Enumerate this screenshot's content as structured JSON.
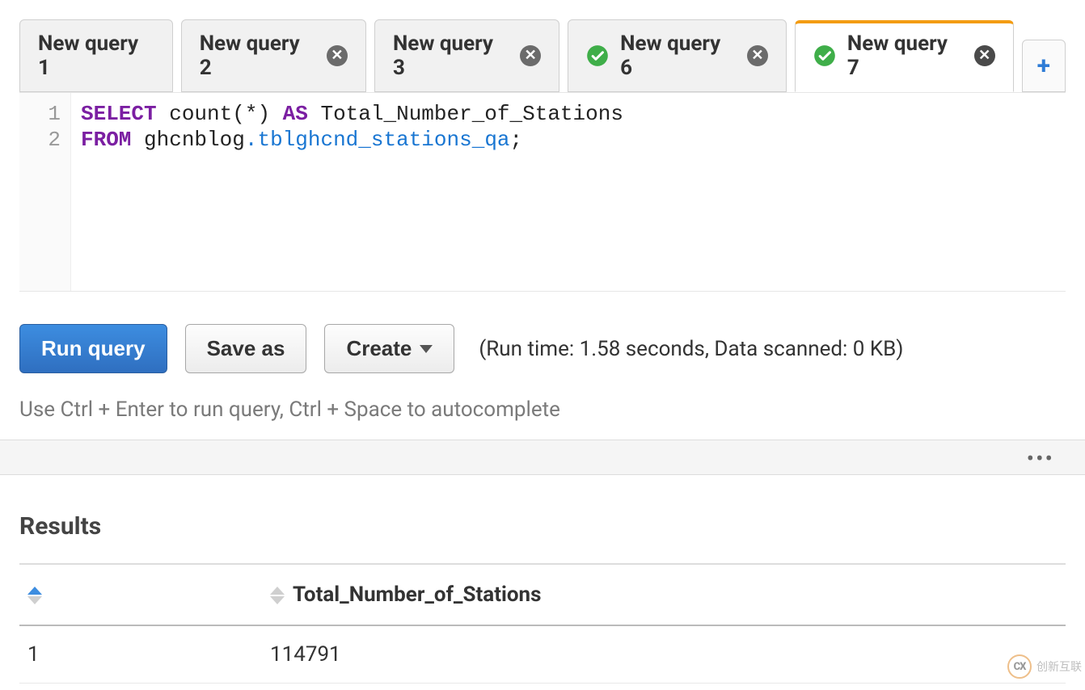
{
  "tabs": {
    "items": [
      {
        "label": "New query 1",
        "closable": false,
        "success": false,
        "active": false
      },
      {
        "label": "New query 2",
        "closable": true,
        "success": false,
        "active": false
      },
      {
        "label": "New query 3",
        "closable": true,
        "success": false,
        "active": false
      },
      {
        "label": "New query 6",
        "closable": true,
        "success": true,
        "active": false
      },
      {
        "label": "New query 7",
        "closable": true,
        "success": true,
        "active": true
      }
    ],
    "add_label": "+"
  },
  "editor": {
    "lines": [
      {
        "n": "1",
        "tokens": [
          {
            "t": "SELECT",
            "c": "kw"
          },
          {
            "t": " count(*) "
          },
          {
            "t": "AS",
            "c": "kw"
          },
          {
            "t": " Total_Number_of_Stations"
          }
        ]
      },
      {
        "n": "2",
        "tokens": [
          {
            "t": "FROM",
            "c": "kw"
          },
          {
            "t": " ghcnblog"
          },
          {
            "t": ".",
            "c": "dot"
          },
          {
            "t": "tblghcnd_stations_qa",
            "c": "tbl"
          },
          {
            "t": ";"
          }
        ]
      }
    ]
  },
  "actions": {
    "run_label": "Run query",
    "save_label": "Save as",
    "create_label": "Create",
    "run_info": "(Run time: 1.58 seconds, Data scanned: 0 KB)",
    "hint": "Use Ctrl + Enter to run query, Ctrl + Space to autocomplete"
  },
  "results": {
    "title": "Results",
    "columns": [
      {
        "key": "__rownum",
        "label": ""
      },
      {
        "key": "Total_Number_of_Stations",
        "label": "Total_Number_of_Stations"
      }
    ],
    "rows": [
      {
        "__rownum": "1",
        "Total_Number_of_Stations": "114791"
      }
    ]
  },
  "watermark": {
    "badge": "CX",
    "text": "创新互联"
  }
}
